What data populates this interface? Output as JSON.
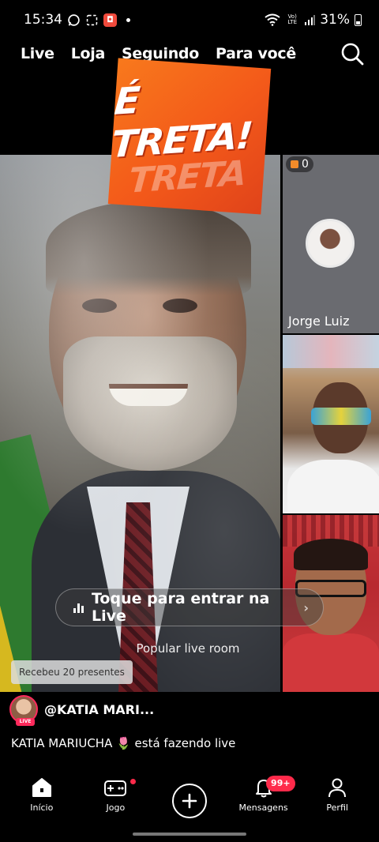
{
  "status_bar": {
    "time": "15:34",
    "battery": "31%",
    "volte": "Vo) LTE"
  },
  "top_nav": {
    "tabs": [
      "Live",
      "Loja",
      "Seguindo",
      "Para você"
    ]
  },
  "main_stream": {
    "sticker_text": "É TRETA!",
    "join_label": "Toque para entrar na Live",
    "room_label": "Popular live room",
    "gifts_label": "Recebeu 20 presentes"
  },
  "guests": [
    {
      "name": "Jorge Luiz",
      "gift_count": "0"
    },
    {
      "name": ""
    },
    {
      "name": ""
    }
  ],
  "host": {
    "handle": "@KATIA MARI...",
    "live_badge": "LIVE",
    "description": "KATIA MARIUCHA 🌷 está fazendo live"
  },
  "bottom_nav": {
    "items": [
      {
        "label": "Início",
        "icon": "home-icon"
      },
      {
        "label": "Jogo",
        "icon": "gamepad-icon"
      },
      {
        "label": "",
        "icon": "plus-icon"
      },
      {
        "label": "Mensagens",
        "icon": "bell-icon",
        "badge": "99+"
      },
      {
        "label": "Perfil",
        "icon": "person-icon"
      }
    ]
  },
  "colors": {
    "accent": "#ff2a4a",
    "sticker": "#f3591a",
    "background": "#000000"
  }
}
